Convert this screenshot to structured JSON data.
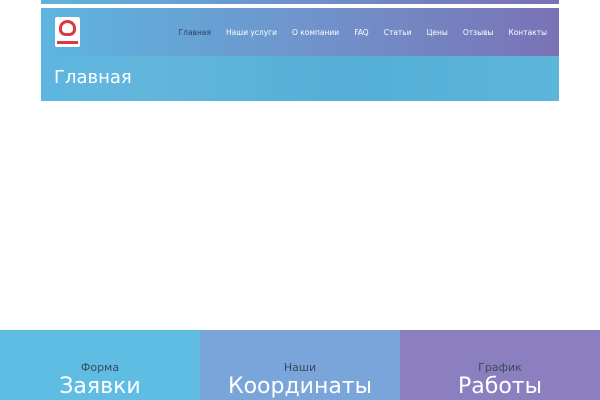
{
  "nav": {
    "items": [
      "Главная",
      "Наши услуги",
      "О компании",
      "FAQ",
      "Статьи",
      "Цены",
      "Отзывы",
      "Контакты"
    ],
    "active": 0
  },
  "banner": {
    "title": "Главная"
  },
  "tiles": [
    {
      "small": "Форма",
      "big": "Заявки",
      "color": "#5fbde3"
    },
    {
      "small": "Наши",
      "big": "Координаты",
      "color": "#79a5da"
    },
    {
      "small": "График",
      "big": "Работы",
      "color": "#8b7fc0"
    }
  ]
}
